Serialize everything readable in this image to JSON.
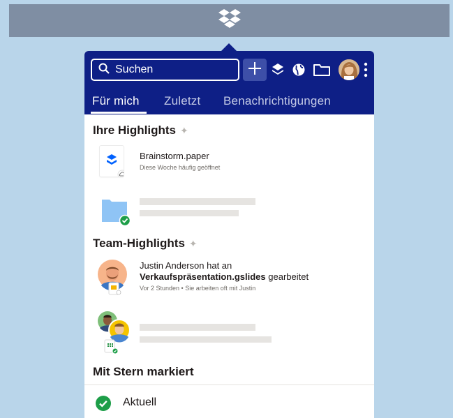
{
  "menubar": {
    "app_icon": "dropbox-logo-icon"
  },
  "header": {
    "search_placeholder": "Suchen",
    "icons": [
      "search-icon",
      "plus-icon",
      "dropbox-icon",
      "globe-icon",
      "folder-icon",
      "avatar",
      "kebab-icon"
    ],
    "tabs": [
      {
        "label": "Für mich",
        "active": true
      },
      {
        "label": "Zuletzt",
        "active": false
      },
      {
        "label": "Benachrichtigungen",
        "active": false
      }
    ]
  },
  "sections": {
    "highlights_title": "Ihre Highlights",
    "team_title": "Team-Highlights",
    "starred_title": "Mit Stern markiert"
  },
  "highlights": [
    {
      "title": "Brainstorm.paper",
      "subtitle": "Diese Woche häufig geöffnet",
      "icon": "paper-file-icon"
    }
  ],
  "team": [
    {
      "actor": "Justin Anderson hat an",
      "file": "Verkaufspräsentation.gslides",
      "action": "gearbeitet",
      "subtitle": "Vor 2 Stunden • Sie arbeiten oft mit Justin"
    }
  ],
  "status": {
    "label": "Aktuell",
    "icon": "check-circle-icon"
  },
  "colors": {
    "header": "#0e1f86",
    "accent_green": "#1d9e48",
    "folder_blue": "#8fc4f5"
  }
}
